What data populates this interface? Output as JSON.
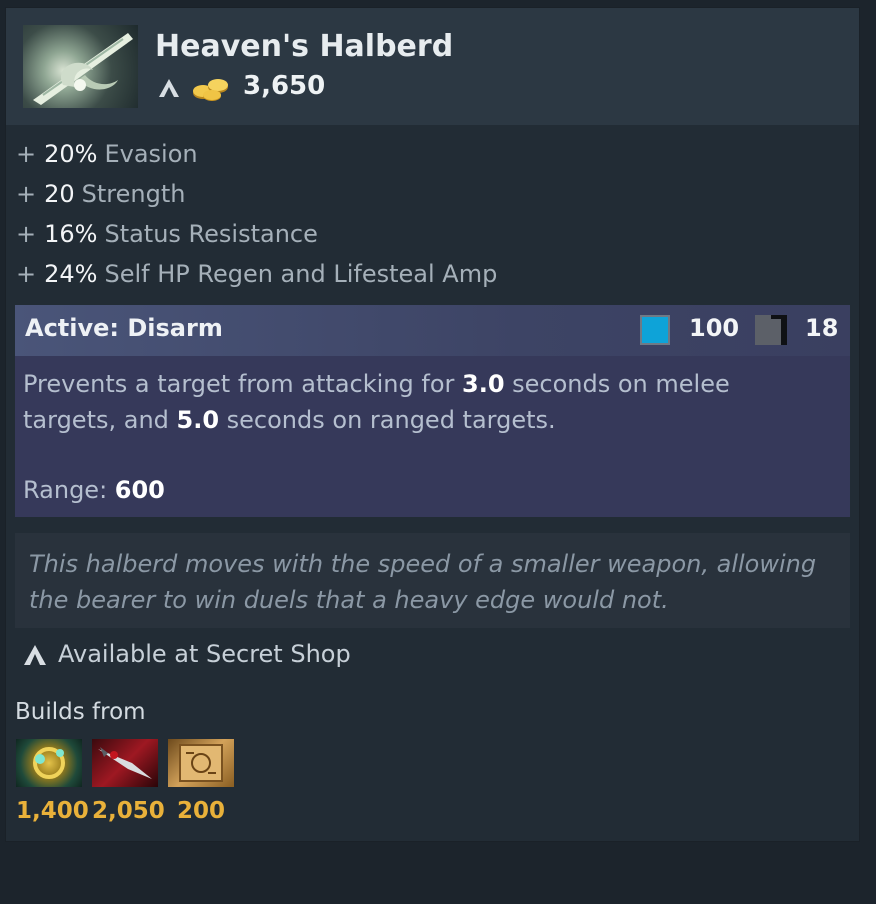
{
  "item": {
    "name": "Heaven's Halberd",
    "cost": "3,650",
    "icon": "heavens-halberd-icon"
  },
  "attributes": [
    {
      "plus": "+",
      "value": "20%",
      "label": "Evasion"
    },
    {
      "plus": "+",
      "value": "20",
      "label": "Strength"
    },
    {
      "plus": "+",
      "value": "16%",
      "label": "Status Resistance"
    },
    {
      "plus": "+",
      "value": "24%",
      "label": "Self HP Regen and Lifesteal Amp"
    }
  ],
  "ability": {
    "title": "Active: Disarm",
    "mana_cost": "100",
    "cooldown": "18",
    "desc_part1": "Prevents a target from attacking for ",
    "melee_duration": "3.0",
    "desc_part2": " seconds on melee targets, and ",
    "ranged_duration": "5.0",
    "desc_part3": " seconds on ranged targets.",
    "range_label": "Range: ",
    "range_value": "600"
  },
  "lore": "This halberd moves with the speed of a smaller weapon, allowing the bearer to win duels that a heavy edge would not.",
  "availability": "Available at Secret Shop",
  "builds": {
    "label": "Builds from",
    "components": [
      {
        "icon": "talisman-of-evasion-icon",
        "cost": "1,400"
      },
      {
        "icon": "sange-icon",
        "cost": "2,050"
      },
      {
        "icon": "recipe-scroll-icon",
        "cost": "200"
      }
    ]
  },
  "colors": {
    "background": "#1c242c",
    "card": "#222c35",
    "header": "#2c3843",
    "ability_panel": "#36395a",
    "mana": "#0ea3d8",
    "gold": "#e9b13a"
  }
}
